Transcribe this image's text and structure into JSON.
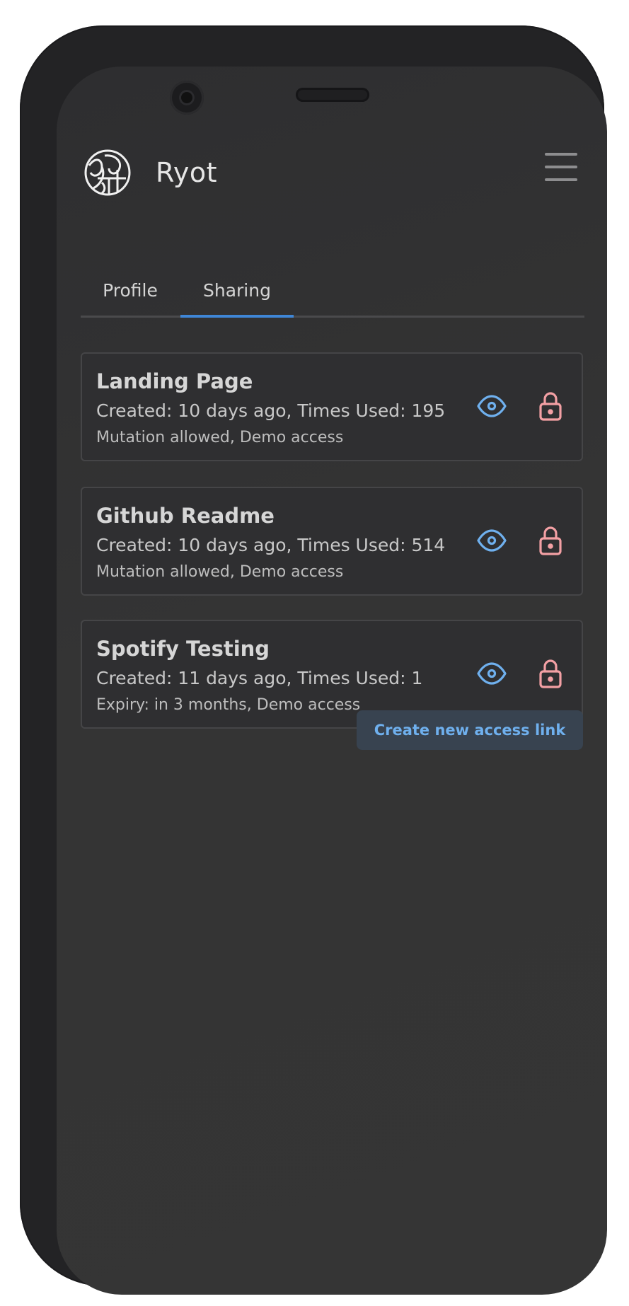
{
  "app": {
    "title": "Ryot"
  },
  "tabs": [
    {
      "label": "Profile",
      "active": false
    },
    {
      "label": "Sharing",
      "active": true
    }
  ],
  "access_links": [
    {
      "name": "Landing Page",
      "meta": "Created: 10 days ago, Times Used: 195",
      "details": "Mutation allowed, Demo access"
    },
    {
      "name": "Github Readme",
      "meta": "Created: 10 days ago, Times Used: 514",
      "details": "Mutation allowed, Demo access"
    },
    {
      "name": "Spotify Testing",
      "meta": "Created: 11 days ago, Times Used: 1",
      "details": "Expiry: in 3 months, Demo access"
    }
  ],
  "actions": {
    "create_link_label": "Create new access link"
  },
  "icons": {
    "logo": "ryot-logo-icon",
    "menu": "hamburger-menu-icon",
    "view": "eye-icon",
    "revoke": "lock-icon"
  },
  "colors": {
    "accent_blue": "#6fb0ee",
    "tab_indicator": "#3f86d6",
    "lock_red": "#f3a0a4",
    "background": "#343434"
  }
}
